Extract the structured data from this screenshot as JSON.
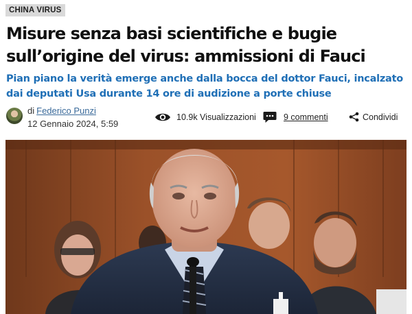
{
  "category": "CHINA VIRUS",
  "article": {
    "title": "Misure senza basi scientifiche e bugie sull’origine del virus: ammissioni di Fauci",
    "subtitle": "Pian piano la verità emerge anche dalla bocca del dottor Fauci, incalzato dai deputati Usa durante 14 ore di audizione a porte chiuse"
  },
  "meta": {
    "by_label": "di",
    "author": "Federico Punzi",
    "date": "12 Gennaio 2024, 5:59",
    "views": "10.9k Visualizzazioni",
    "comments": "9 commenti",
    "share": "Condividi"
  },
  "colors": {
    "accent": "#1f6fb6",
    "category_bg": "#d9d9d9"
  },
  "icons": {
    "views": "eye-icon",
    "comments": "comment-bubble-icon",
    "share": "share-icon"
  }
}
